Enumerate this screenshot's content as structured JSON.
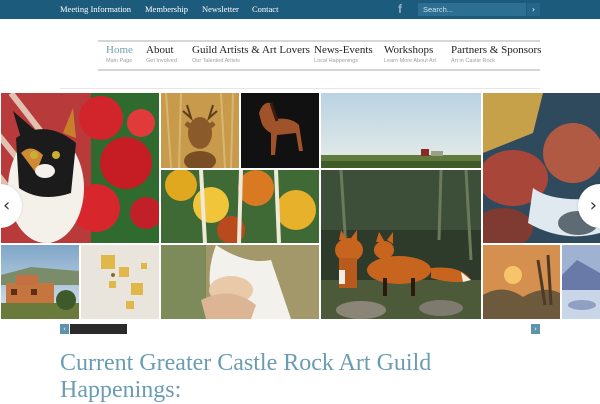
{
  "topbar": {
    "links": [
      "Meeting Information",
      "Membership",
      "Newsletter",
      "Contact"
    ],
    "facebook_icon": "facebook-icon",
    "search_placeholder": "Search...",
    "search_button": "›"
  },
  "nav": [
    {
      "label": "Home",
      "sub": "Main Page"
    },
    {
      "label": "About",
      "sub": "Get Involved"
    },
    {
      "label": "Guild Artists & Art Lovers",
      "sub": "Our Talented Artists"
    },
    {
      "label": "News-Events",
      "sub": "Local Happenings"
    },
    {
      "label": "Workshops",
      "sub": "Learn More About Art"
    },
    {
      "label": "Partners & Sponsors",
      "sub": "Art in Castle Rock"
    }
  ],
  "gallery": {
    "prev_icon": "‹",
    "next_icon": "›"
  },
  "pager": {
    "prev": "‹",
    "next": "›"
  },
  "main": {
    "heading": "Current Greater Castle Rock Art Guild Happenings:"
  },
  "colors": {
    "topbar": "#1d5b7d",
    "accent": "#6a9db3",
    "active_nav": "#6fa0b3"
  }
}
